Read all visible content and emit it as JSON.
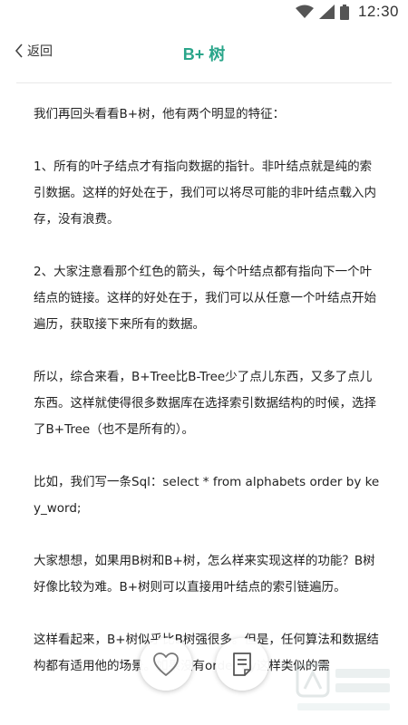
{
  "status_bar": {
    "time": "12:30",
    "icons": [
      "wifi-icon",
      "cellular-signal-icon",
      "battery-icon"
    ]
  },
  "header": {
    "back_label": "返回",
    "title": "B+ 树"
  },
  "article": {
    "paragraphs": [
      "我们再回头看看B+树，他有两个明显的特征：",
      "1、所有的叶子结点才有指向数据的指针。非叶结点就是纯的索引数据。这样的好处在于，我们可以将尽可能的非叶结点载入内存，没有浪费。",
      "2、大家注意看那个红色的箭头，每个叶结点都有指向下一个叶结点的链接。这样的好处在于，我们可以从任意一个叶结点开始遍历，获取接下来所有的数据。",
      "所以，综合来看，B+Tree比B-Tree少了点儿东西，又多了点儿东西。这样就使得很多数据库在选择索引数据结构的时候，选择了B+Tree（也不是所有的）。",
      "比如，我们写一条Sql：select * from alphabets order by key_word;",
      "大家想想，如果用B树和B+树，怎么样来实现这样的功能？B树好像比较为难。B+树则可以直接用叶结点的索引链遍历。",
      "这样看起来，B+树似乎比B树强很多。但是，任何算法和数据结构都有适用他的场景。如果没有order by这样类似的需"
    ]
  },
  "actions": {
    "like_icon": "heart-icon",
    "notes_icon": "notes-icon"
  },
  "colors": {
    "accent": "#2aa58a",
    "text": "#222222",
    "divider": "#e8e8e8"
  }
}
